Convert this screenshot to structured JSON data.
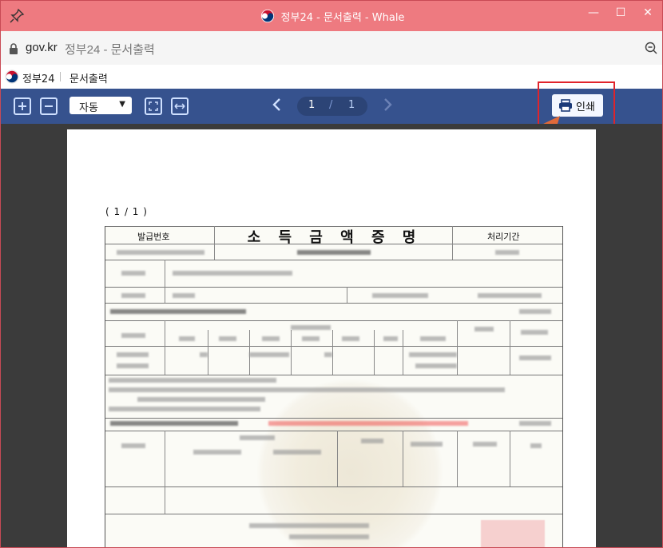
{
  "window": {
    "title": "정부24 - 문서출력 - Whale",
    "controls": {
      "minimize": "—",
      "maximize": "☐",
      "close": "✕"
    }
  },
  "address_bar": {
    "host": "gov.kr",
    "page_title": "정부24 - 문서출력"
  },
  "site_header": {
    "site_name": "정부24",
    "page_name": "문서출력"
  },
  "toolbar": {
    "zoom_mode": "자동",
    "page_current": "1",
    "page_separator": "/",
    "page_total": "1",
    "print_label": "인쇄",
    "prev_glyph": "‹",
    "next_glyph": "›"
  },
  "document": {
    "page_indicator": "( 1 / 1 )",
    "form_title": "소 득 금 액 증 명",
    "issue_number_label": "발급번호",
    "processing_period_label": "처리기간"
  },
  "colors": {
    "titlebar": "#ee7a80",
    "toolbar": "#36528e",
    "highlight": "#e0242b",
    "arrow": "#e06a3a"
  }
}
